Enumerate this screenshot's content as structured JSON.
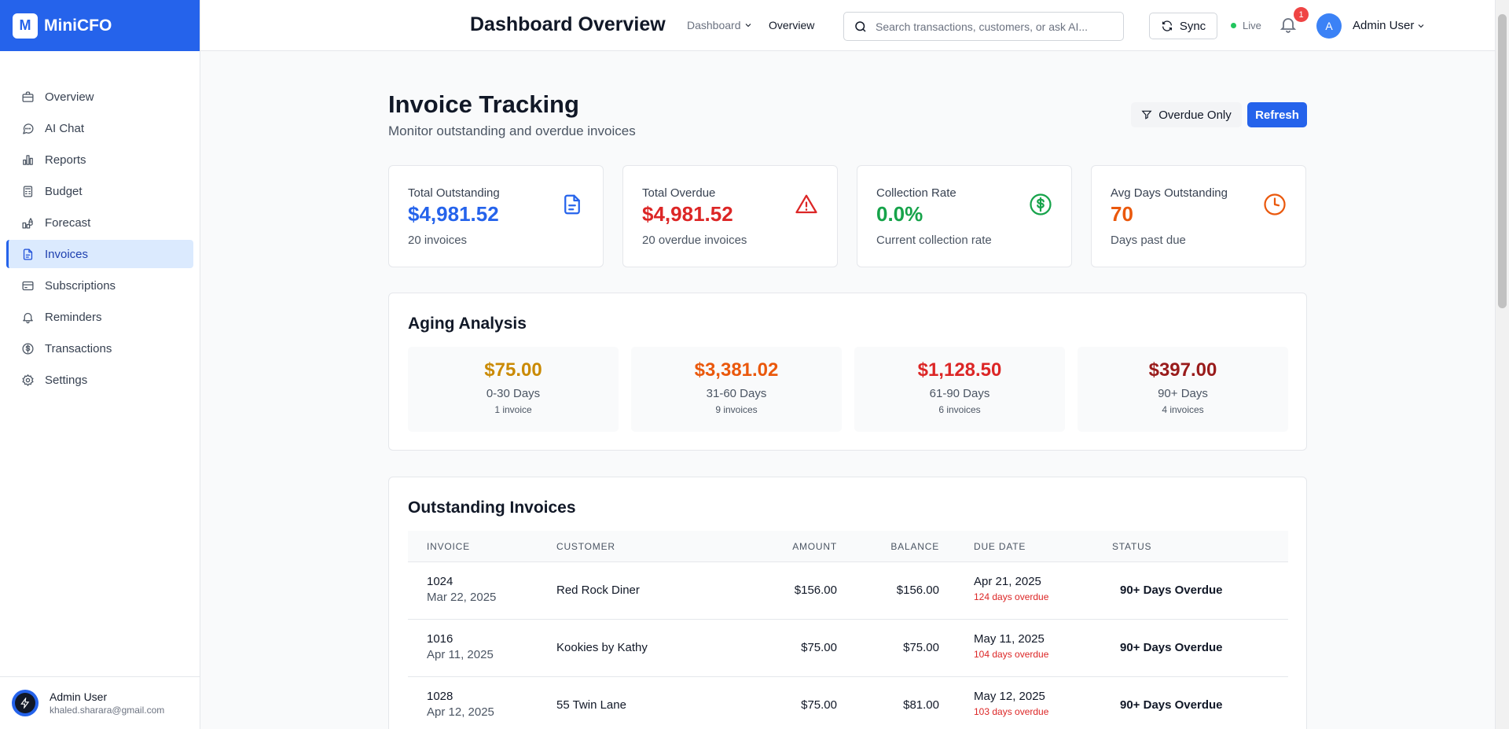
{
  "app": {
    "logo_letter": "M",
    "name": "MiniCFO"
  },
  "sidebar": {
    "items": [
      {
        "label": "Overview",
        "icon": "briefcase-icon"
      },
      {
        "label": "AI Chat",
        "icon": "chat-icon"
      },
      {
        "label": "Reports",
        "icon": "bar-chart-icon"
      },
      {
        "label": "Budget",
        "icon": "calculator-icon"
      },
      {
        "label": "Forecast",
        "icon": "forecast-icon"
      },
      {
        "label": "Invoices",
        "icon": "document-icon",
        "active": true
      },
      {
        "label": "Subscriptions",
        "icon": "credit-card-icon"
      },
      {
        "label": "Reminders",
        "icon": "bell-icon"
      },
      {
        "label": "Transactions",
        "icon": "dollar-circle-icon"
      },
      {
        "label": "Settings",
        "icon": "gear-icon"
      }
    ],
    "user": {
      "name": "Admin User",
      "email": "khaled.sharara@gmail.com"
    }
  },
  "header": {
    "title": "Dashboard Overview",
    "breadcrumb_dropdown": "Dashboard",
    "breadcrumb_current": "Overview",
    "search_placeholder": "Search transactions, customers, or ask AI...",
    "sync_label": "Sync",
    "live_label": "Live",
    "notification_count": "1",
    "avatar_letter": "A",
    "user_name": "Admin User"
  },
  "page": {
    "title": "Invoice Tracking",
    "subtitle": "Monitor outstanding and overdue invoices",
    "filter_label": "Overdue Only",
    "refresh_label": "Refresh"
  },
  "stats": [
    {
      "label": "Total Outstanding",
      "value": "$4,981.52",
      "note": "20 invoices",
      "color": "#2563eb",
      "icon": "document-icon"
    },
    {
      "label": "Total Overdue",
      "value": "$4,981.52",
      "note": "20 overdue invoices",
      "color": "#dc2626",
      "icon": "warning-icon"
    },
    {
      "label": "Collection Rate",
      "value": "0.0%",
      "note": "Current collection rate",
      "color": "#16a34a",
      "icon": "dollar-circle-icon"
    },
    {
      "label": "Avg Days Outstanding",
      "value": "70",
      "note": "Days past due",
      "color": "#ea580c",
      "icon": "clock-icon"
    }
  ],
  "aging": {
    "title": "Aging Analysis",
    "buckets": [
      {
        "amount": "$75.00",
        "range": "0-30 Days",
        "count": "1 invoice",
        "color": "#ca8a04"
      },
      {
        "amount": "$3,381.02",
        "range": "31-60 Days",
        "count": "9 invoices",
        "color": "#ea580c"
      },
      {
        "amount": "$1,128.50",
        "range": "61-90 Days",
        "count": "6 invoices",
        "color": "#dc2626"
      },
      {
        "amount": "$397.00",
        "range": "90+ Days",
        "count": "4 invoices",
        "color": "#991b1b"
      }
    ]
  },
  "invoices": {
    "title": "Outstanding Invoices",
    "columns": [
      "INVOICE",
      "CUSTOMER",
      "AMOUNT",
      "BALANCE",
      "DUE DATE",
      "STATUS"
    ],
    "rows": [
      {
        "number": "1024",
        "issued": "Mar 22, 2025",
        "customer": "Red Rock Diner",
        "amount": "$156.00",
        "balance": "$156.00",
        "due": "Apr 21, 2025",
        "overdue": "124 days overdue",
        "status": "90+ Days Overdue"
      },
      {
        "number": "1016",
        "issued": "Apr 11, 2025",
        "customer": "Kookies by Kathy",
        "amount": "$75.00",
        "balance": "$75.00",
        "due": "May 11, 2025",
        "overdue": "104 days overdue",
        "status": "90+ Days Overdue"
      },
      {
        "number": "1028",
        "issued": "Apr 12, 2025",
        "customer": "55 Twin Lane",
        "amount": "$75.00",
        "balance": "$81.00",
        "due": "May 12, 2025",
        "overdue": "103 days overdue",
        "status": "90+ Days Overdue"
      }
    ]
  }
}
